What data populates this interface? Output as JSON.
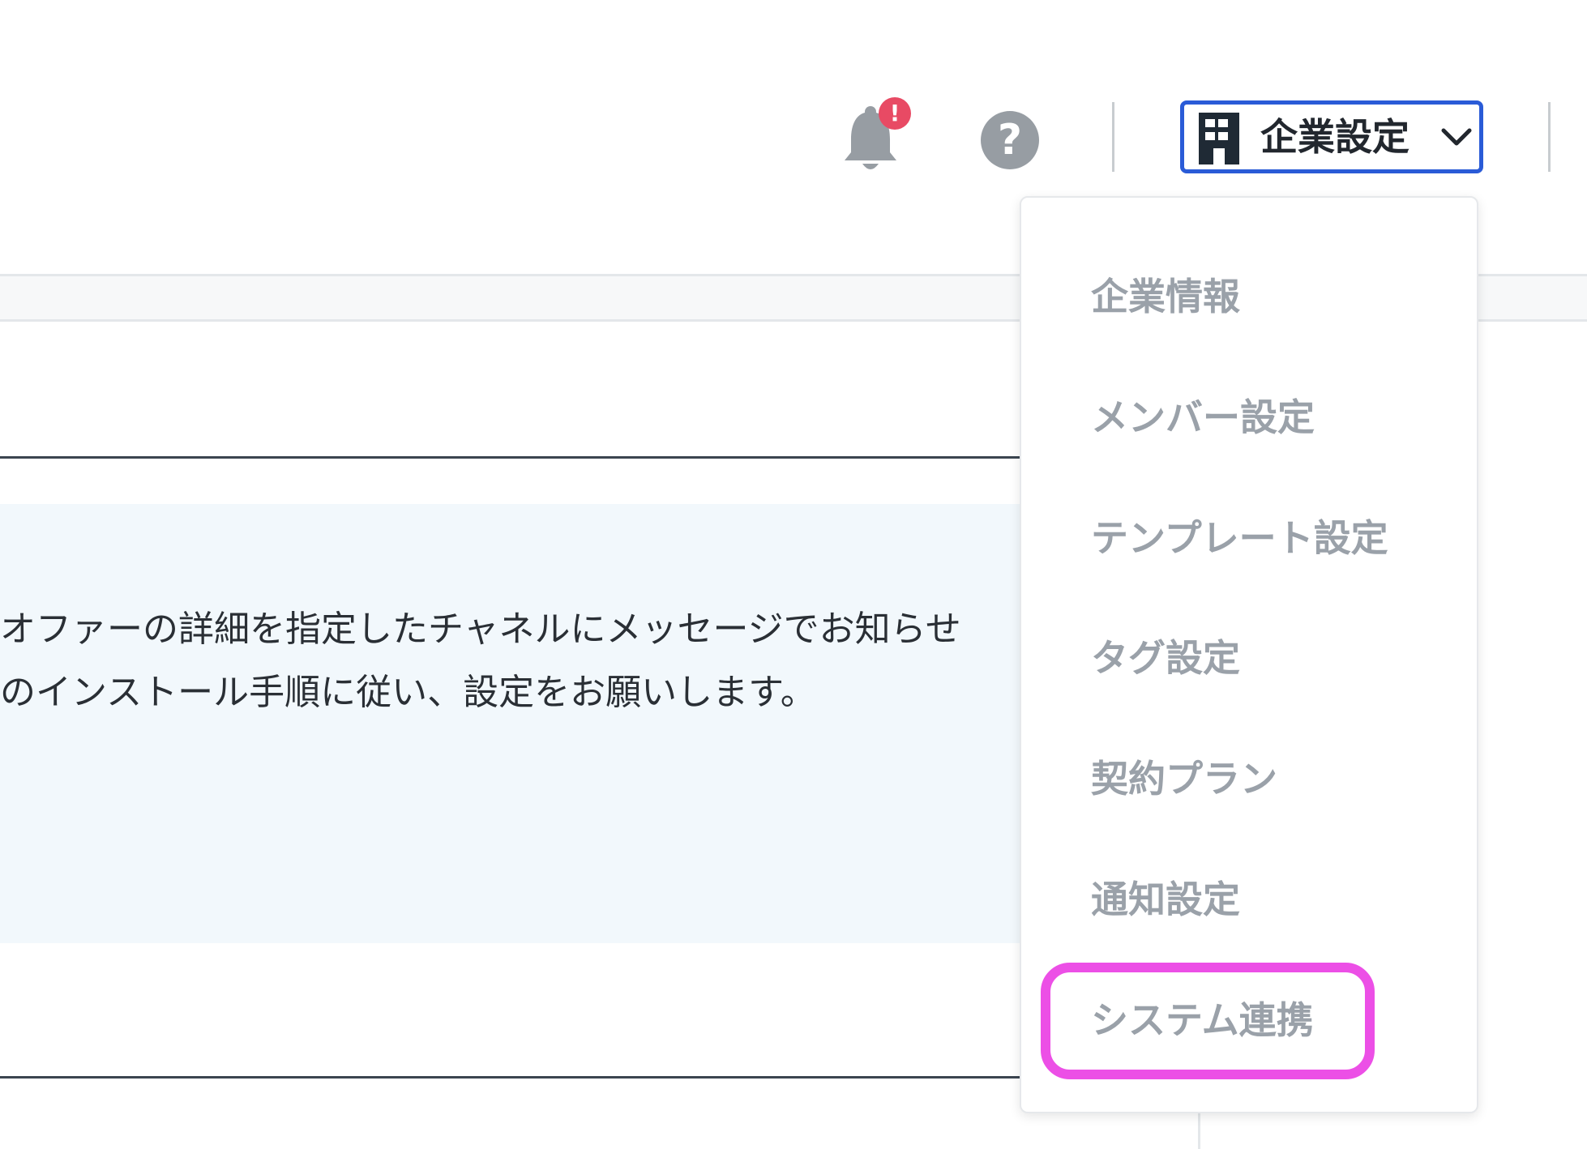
{
  "header": {
    "notification_badge": "!",
    "help_symbol": "?",
    "company_button_label": "企業設定"
  },
  "content": {
    "line1": "オファーの詳細を指定したチャネルにメッセージでお知らせ",
    "line2": "のインストール手順に従い、設定をお願いします。"
  },
  "dropdown": {
    "items": [
      {
        "label": "企業情報"
      },
      {
        "label": "メンバー設定"
      },
      {
        "label": "テンプレート設定"
      },
      {
        "label": "タグ設定"
      },
      {
        "label": "契約プラン"
      },
      {
        "label": "通知設定"
      },
      {
        "label": "システム連携"
      }
    ]
  },
  "colors": {
    "accent_border": "#2a5bd7",
    "highlight": "#ec4fe6",
    "badge": "#e84a64",
    "menu_text": "#9aa1a9",
    "icon_gray": "#979da3",
    "info_background": "#f2f8fc"
  },
  "icons": {
    "bell": "bell-icon",
    "help": "help-icon",
    "company": "building-icon",
    "dropdown": "chevron-down-icon"
  }
}
